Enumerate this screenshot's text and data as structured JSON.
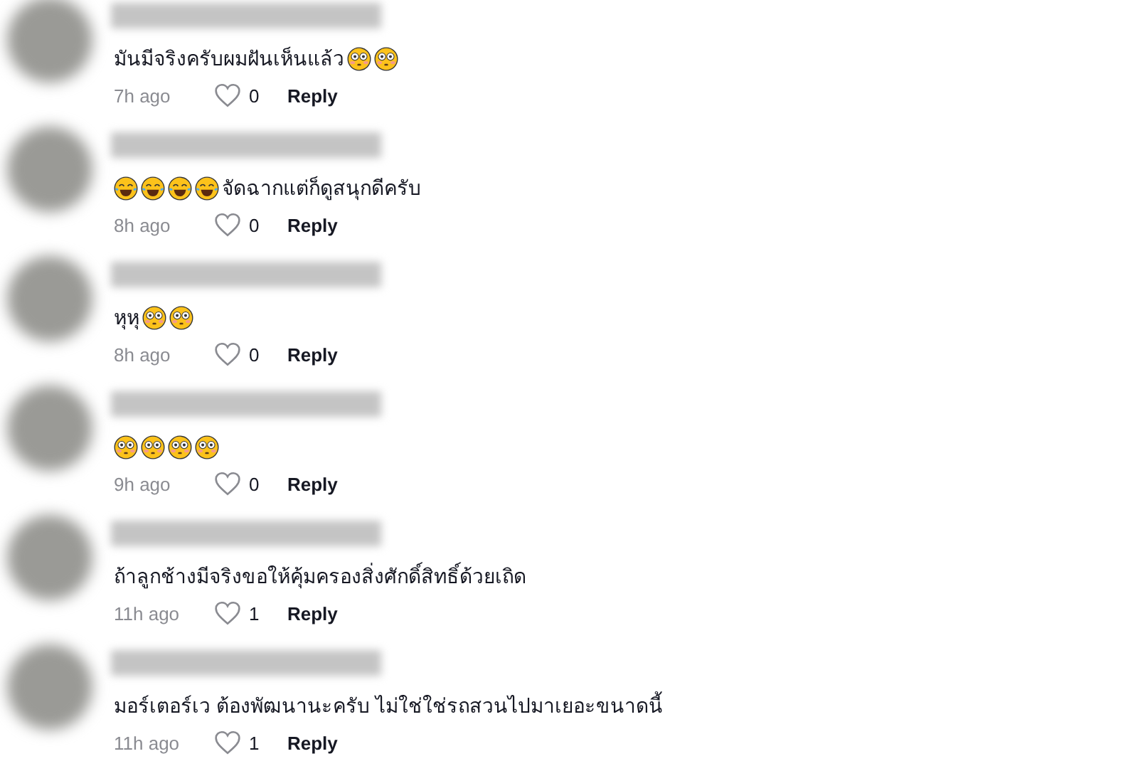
{
  "comments": [
    {
      "content": [
        {
          "kind": "text",
          "text": "มันมีจริงครับผมฝันเห็นแล้ว"
        },
        {
          "kind": "flushed"
        },
        {
          "kind": "flushed"
        }
      ],
      "time": "7h ago",
      "likes": "0",
      "reply": "Reply"
    },
    {
      "content": [
        {
          "kind": "joy"
        },
        {
          "kind": "joy"
        },
        {
          "kind": "joy"
        },
        {
          "kind": "joy"
        },
        {
          "kind": "text",
          "text": "จัดฉากแต่ก็ดูสนุกดีครับ"
        }
      ],
      "time": "8h ago",
      "likes": "0",
      "reply": "Reply"
    },
    {
      "content": [
        {
          "kind": "text",
          "text": "หุหุ"
        },
        {
          "kind": "flushed"
        },
        {
          "kind": "flushed"
        }
      ],
      "time": "8h ago",
      "likes": "0",
      "reply": "Reply"
    },
    {
      "content": [
        {
          "kind": "flushed"
        },
        {
          "kind": "flushed"
        },
        {
          "kind": "flushed"
        },
        {
          "kind": "flushed"
        }
      ],
      "time": "9h ago",
      "likes": "0",
      "reply": "Reply"
    },
    {
      "content": [
        {
          "kind": "text",
          "text": "ถ้าลูกช้างมีจริงขอให้คุ้มครองสิ่งศักดิ์สิทธิ์ด้วยเถิด"
        }
      ],
      "time": "11h ago",
      "likes": "1",
      "reply": "Reply"
    },
    {
      "content": [
        {
          "kind": "text",
          "text": "มอร์เตอร์เว ต้องพัฒนานะครับ ไม่ใช่ใช่รถสวนไปมาเยอะขนาดนี้"
        }
      ],
      "time": "11h ago",
      "likes": "1",
      "reply": "Reply"
    }
  ]
}
